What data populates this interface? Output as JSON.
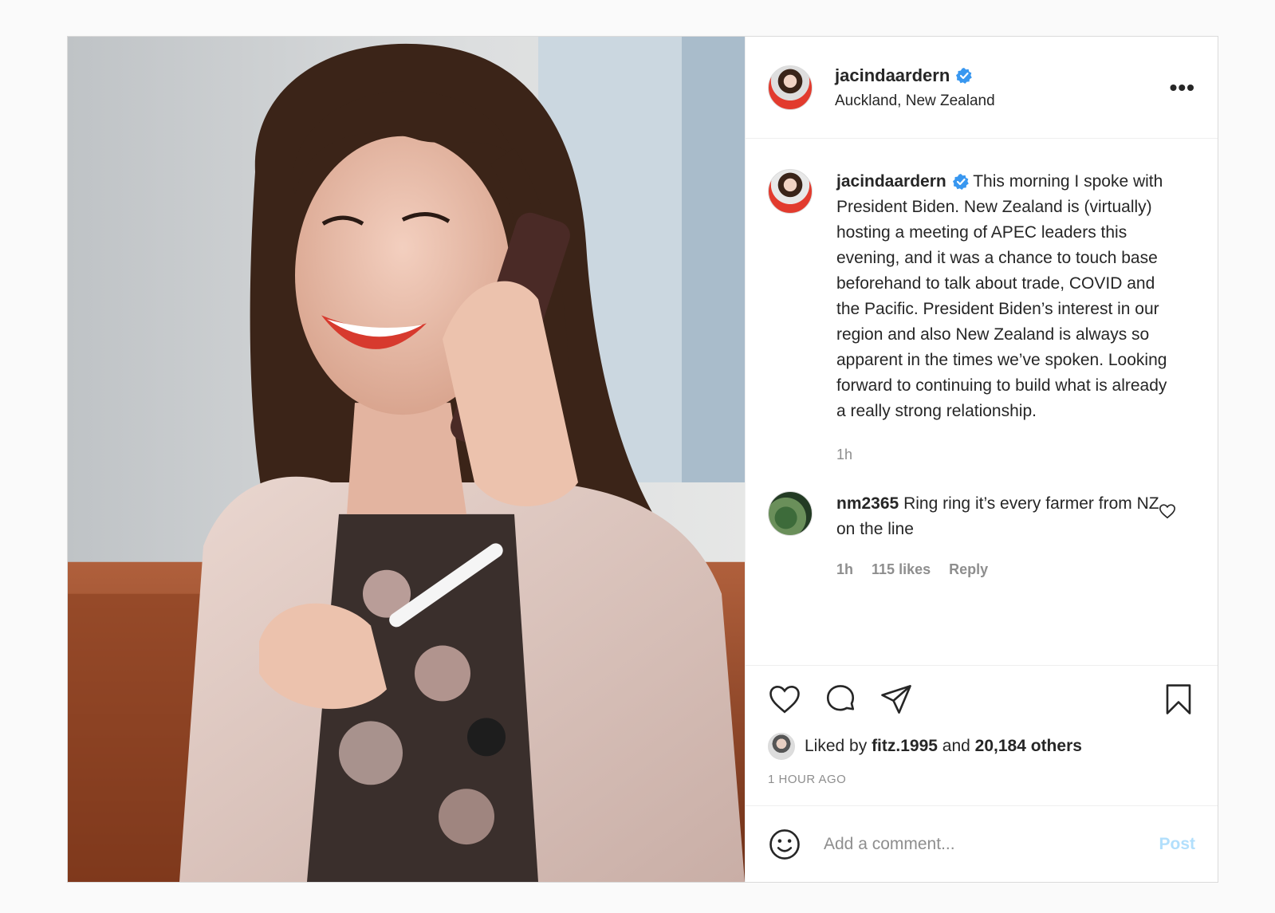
{
  "post": {
    "username": "jacindaardern",
    "location": "Auckland, New Zealand",
    "more_label": "•••",
    "verified_color": "#3897f0"
  },
  "caption": {
    "username": "jacindaardern",
    "text": "This morning I spoke with President Biden. New Zealand is (virtually) hosting a meeting of APEC leaders this evening, and it was a chance to touch base beforehand to talk about trade, COVID and the Pacific. President Biden’s interest in our region and also New Zealand is always so apparent in the times we’ve spoken. Looking forward to continuing to build what is already a really strong relationship.",
    "time": "1h"
  },
  "comment": {
    "username": "nm2365",
    "text": "Ring ring it’s every farmer from NZ on the line",
    "time": "1h",
    "likes": "115 likes",
    "reply": "Reply"
  },
  "actions": {
    "icons": [
      "heart-icon",
      "comment-icon",
      "share-icon",
      "bookmark-icon"
    ]
  },
  "likes": {
    "prefix": "Liked by",
    "user": "fitz.1995",
    "middle": "and",
    "others": "20,184 others"
  },
  "timestamp": "1 HOUR AGO",
  "add_comment": {
    "placeholder": "Add a comment...",
    "post_label": "Post",
    "post_color": "#b2dffc"
  }
}
